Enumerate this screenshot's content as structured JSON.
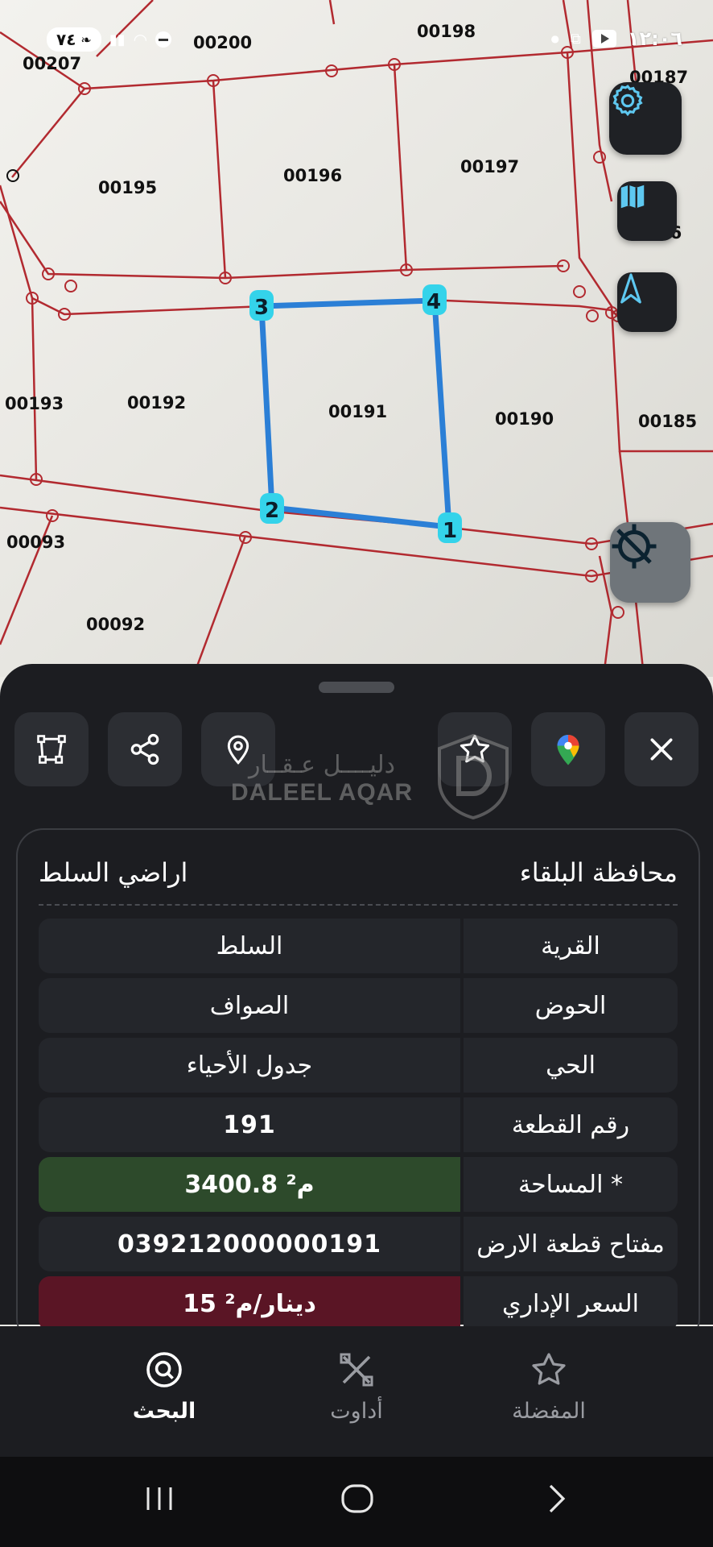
{
  "status_bar": {
    "time": "١٢:٠٦",
    "left_pill": "٧٤",
    "network": "4G"
  },
  "map": {
    "parcels": [
      "00207",
      "00200",
      "00198",
      "00187",
      "00195",
      "00196",
      "00197",
      "00186",
      "00193",
      "00192",
      "00191",
      "00190",
      "00185",
      "00093",
      "00092"
    ],
    "selected_vertices": [
      "1",
      "2",
      "3",
      "4"
    ]
  },
  "fabs": {
    "settings": "gear-icon",
    "layers": "map-icon",
    "compass": "navigation-arrow-icon",
    "gps": "gps-off-icon"
  },
  "toolbar": {
    "buttons": [
      "polygon-icon",
      "share-icon",
      "location-pin-icon",
      "favorite-star-icon",
      "google-maps-icon",
      "close-icon"
    ]
  },
  "watermark": {
    "arabic": "دليــــل عـقــار",
    "english": "DALEEL AQAR"
  },
  "card": {
    "governorate": "محافظة البلقاء",
    "lands": "اراضي السلط",
    "rows": [
      {
        "label": "القرية",
        "value": "السلط"
      },
      {
        "label": "الحوض",
        "value": "الصواف"
      },
      {
        "label": "الحي",
        "value": "جدول الأحياء"
      },
      {
        "label": "رقم القطعة",
        "value": "191"
      },
      {
        "label": "المساحة *",
        "value": "3400.8 م²"
      },
      {
        "label": "مفتاح قطعة الارض",
        "value": "039212000000191"
      },
      {
        "label": "السعر الإداري",
        "value": "15 دينار/م²"
      }
    ]
  },
  "bottom_nav": {
    "search": "البحث",
    "tools": "أداوت",
    "favorites": "المفضلة"
  },
  "colors": {
    "parcel_line": "#b22a30",
    "selection": "#2b7fd6",
    "vertex": "#34d3ea",
    "area_bg": "#2d4a2b",
    "price_bg": "#5a1525"
  }
}
